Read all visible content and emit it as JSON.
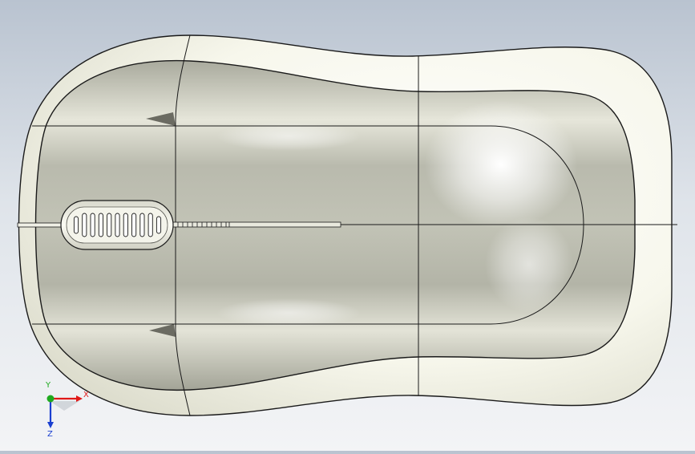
{
  "scene": {
    "view": "top",
    "model": "computer mouse",
    "background_top": "#b9c3d0",
    "background_bottom": "#f3f4f6",
    "body_color": "#f5f5e8",
    "buttons_color": "#c9cabd",
    "edge_color": "#1a1a1a"
  },
  "triad": {
    "x_label": "X",
    "y_label": "Y",
    "z_label": "Z",
    "x_color": "#e01818",
    "y_color": "#1faa1f",
    "z_color": "#1a3fd0"
  },
  "scroll_wheel": {
    "notch_count": 11
  }
}
